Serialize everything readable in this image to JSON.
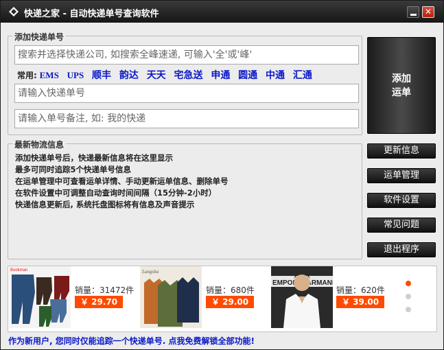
{
  "window": {
    "title": "快递之家 - 自动快递单号查询软件",
    "close_glyph": "✕"
  },
  "add_section": {
    "legend": "添加快递单号",
    "company_placeholder": "搜索并选择快递公司, 如搜索全峰速递, 可输入'全'或'峰'",
    "common_label": "常用:",
    "carriers": [
      "EMS",
      "UPS",
      "顺丰",
      "韵达",
      "天天",
      "宅急送",
      "申通",
      "圆通",
      "中通",
      "汇通"
    ],
    "number_placeholder": "请输入快递单号",
    "note_placeholder": "请输入单号备注, 如: 我的快递"
  },
  "info_section": {
    "legend": "最新物流信息",
    "lines": [
      "添加快递单号后，快递最新信息将在这里显示",
      "最多可同时追踪5个快递单号信息",
      "在运单管理中可查看运单详情、手动更新运单信息、删除单号",
      "在软件设置中可调整自动查询时间间隔（15分钟-2小时）",
      "快递信息更新后, 系统托盘图标将有信息及声音提示"
    ]
  },
  "buttons": {
    "add_line1": "添加",
    "add_line2": "运单",
    "update": "更新信息",
    "manage": "运单管理",
    "settings": "软件设置",
    "faq": "常见问题",
    "exit": "退出程序"
  },
  "ads": {
    "items": [
      {
        "sales": "销量：31472件",
        "price": "￥ 29.70",
        "brand": "Bookman"
      },
      {
        "sales": "销量：680件",
        "price": "￥ 29.00",
        "brand": "Langsha"
      },
      {
        "sales": "销量：620件",
        "price": "￥ 39.00",
        "brand": "EMPORIO ARMANI"
      }
    ],
    "active_slide": 1,
    "slide_count": 3
  },
  "footer": {
    "notice": "作为新用户, 您同时仅能追踪一个快递单号. 点我免费解锁全部功能!"
  }
}
